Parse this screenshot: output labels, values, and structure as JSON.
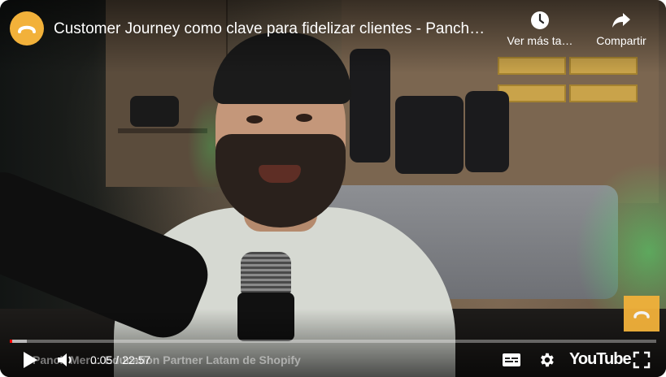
{
  "header": {
    "title": "Customer Journey como clave para fidelizar clientes - Panch…",
    "watch_later_label": "Ver más ta…",
    "share_label": "Compartir"
  },
  "icons": {
    "avatar": "channel-logo-icon",
    "watch_later": "clock-icon",
    "share": "share-arrow-icon",
    "play": "play-icon",
    "volume": "volume-icon",
    "subtitles": "subtitles-icon",
    "settings": "gear-icon",
    "fullscreen": "fullscreen-icon",
    "brand": "channel-watermark-icon"
  },
  "player": {
    "current_time": "0:05",
    "separator": "/",
    "duration": "22:57",
    "progress_fraction": 0.0036,
    "loaded_fraction": 0.027,
    "lower_third_text": "Panch Mer… Education Partner Latam de Shopify",
    "logo_text": "YouTube"
  },
  "colors": {
    "brand_yellow": "#f2b13a",
    "progress_red": "#ff0000"
  }
}
